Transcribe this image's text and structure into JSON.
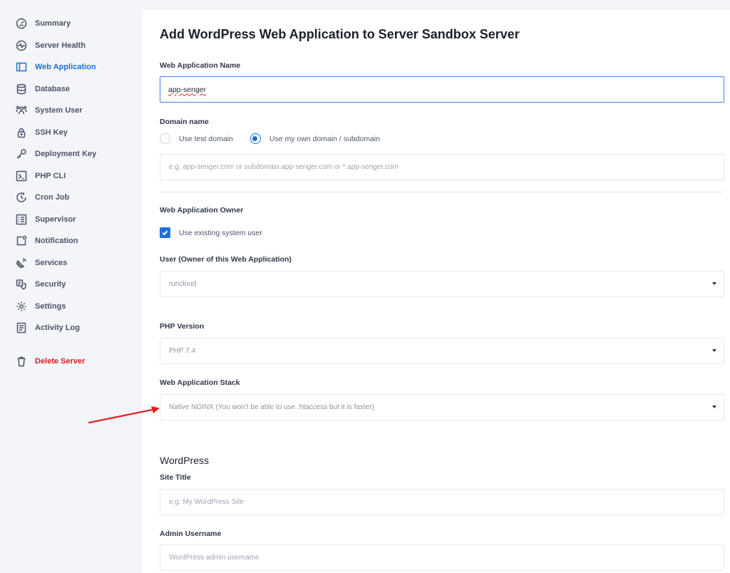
{
  "sidebar": {
    "items": [
      {
        "label": "Summary",
        "icon": "gauge-icon"
      },
      {
        "label": "Server Health",
        "icon": "heartbeat-icon"
      },
      {
        "label": "Web Application",
        "icon": "browser-window-icon"
      },
      {
        "label": "Database",
        "icon": "database-icon"
      },
      {
        "label": "System User",
        "icon": "users-icon"
      },
      {
        "label": "SSH Key",
        "icon": "lock-icon"
      },
      {
        "label": "Deployment Key",
        "icon": "key-icon"
      },
      {
        "label": "PHP CLI",
        "icon": "terminal-icon"
      },
      {
        "label": "Cron Job",
        "icon": "clock-icon"
      },
      {
        "label": "Supervisor",
        "icon": "list-icon"
      },
      {
        "label": "Notification",
        "icon": "bell-icon"
      },
      {
        "label": "Services",
        "icon": "satellite-icon"
      },
      {
        "label": "Security",
        "icon": "shield-icon"
      },
      {
        "label": "Settings",
        "icon": "gear-icon"
      },
      {
        "label": "Activity Log",
        "icon": "log-icon"
      }
    ],
    "active_index": 2,
    "delete_label": "Delete Server",
    "accent_color": "#1f6fd8",
    "danger_color": "#d21f1f"
  },
  "page": {
    "title": "Add WordPress Web Application to Server Sandbox Server"
  },
  "form": {
    "app_name": {
      "label": "Web Application Name",
      "value": "app-senger"
    },
    "domain": {
      "label": "Domain name",
      "option_test": "Use test domain",
      "option_own": "Use my own domain / subdomain",
      "selected": "own",
      "placeholder": "e.g: app-senger.com or subdomain.app-senger.com or *.app-senger.com"
    },
    "owner": {
      "label": "Web Application Owner",
      "checkbox_label": "Use existing system user",
      "checked": true
    },
    "user": {
      "label": "User (Owner of this Web Application)",
      "value": "runcloud"
    },
    "php": {
      "label": "PHP Version",
      "value": "PHP 7.4"
    },
    "stack": {
      "label": "Web Application Stack",
      "value": "Native NGINX (You won't be able to use .htaccess but it is faster)"
    },
    "wordpress": {
      "section_title": "WordPress",
      "site_title": {
        "label": "Site Title",
        "placeholder": "e.g: My WordPress Site"
      },
      "admin_username": {
        "label": "Admin Username",
        "placeholder": "WordPress admin username"
      }
    }
  },
  "annotation": {
    "arrow_color": "#e02020"
  }
}
